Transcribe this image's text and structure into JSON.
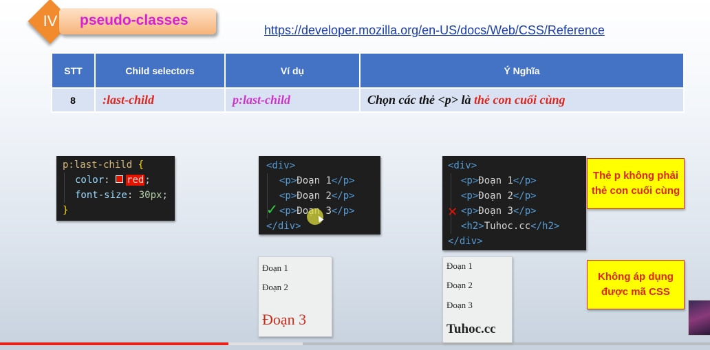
{
  "header": {
    "roman_numeral": "IV",
    "title": "pseudo-classes",
    "reference_url": "https://developer.mozilla.org/en-US/docs/Web/CSS/Reference"
  },
  "table": {
    "headers": [
      "STT",
      "Child selectors",
      "Ví dụ",
      "Ý Nghĩa"
    ],
    "row": {
      "stt": "8",
      "selector": ":last-child",
      "example": "p:last-child",
      "meaning_prefix": "Chọn các thẻ <p> là ",
      "meaning_highlight": "thẻ con cuối cùng"
    }
  },
  "css_code": {
    "selector": "p:last-child",
    "open_brace": "{",
    "prop1": "color",
    "val1": "red",
    "prop2": "font-size",
    "val2": "30px",
    "close_brace": "}"
  },
  "html_code_1": {
    "open_div": "<div>",
    "lines": [
      "Đoạn 1",
      "Đoạn 2",
      "Đoạn 3"
    ],
    "close_div": "</div>",
    "check_mark": "✓"
  },
  "html_code_2": {
    "open_div": "<div>",
    "lines": [
      "Đoạn 1",
      "Đoạn 2",
      "Đoạn 3"
    ],
    "h2_text": "Tuhoc.cc",
    "close_div": "</div>",
    "cross_mark": "✕"
  },
  "preview_1": {
    "p1": "Đoạn 1",
    "p2": "Đoạn 2",
    "p3": "Đoạn 3"
  },
  "preview_2": {
    "p1": "Đoạn 1",
    "p2": "Đoạn 2",
    "p3": "Đoạn 3",
    "h2": "Tuhoc.cc"
  },
  "notes": {
    "note1": "Thẻ p không phải thẻ con cuối cùng",
    "note2": "Không áp dụng được mã CSS"
  },
  "video": {
    "played_fraction": 0.322,
    "buffered_fraction": 0.426
  },
  "colors": {
    "header_bg": "#4472c4",
    "row_bg": "#d9e2f3",
    "selector_red": "#e0241b",
    "example_magenta": "#cc33cc",
    "note_yellow": "#ffff00"
  }
}
